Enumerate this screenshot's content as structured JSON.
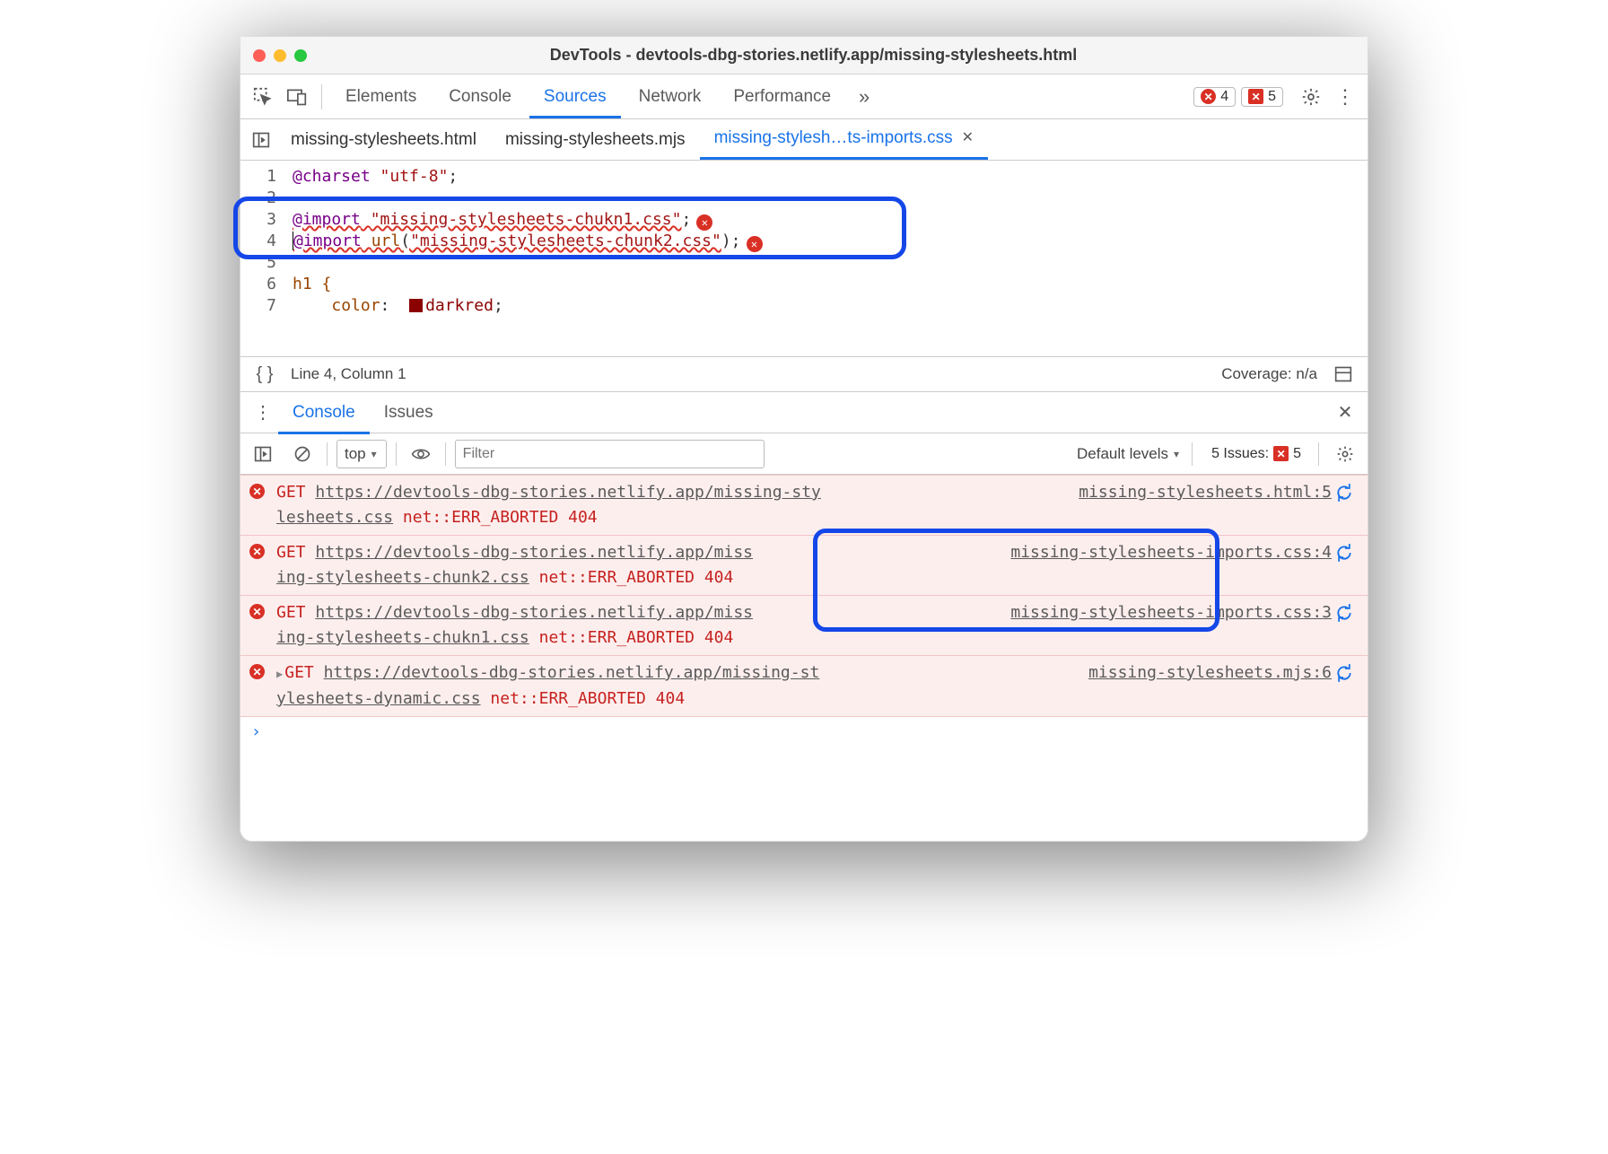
{
  "window_title": "DevTools - devtools-dbg-stories.netlify.app/missing-stylesheets.html",
  "panels": {
    "elements": "Elements",
    "console": "Console",
    "sources": "Sources",
    "network": "Network",
    "performance": "Performance"
  },
  "error_count": "4",
  "issue_count": "5",
  "file_tabs": {
    "t1": "missing-stylesheets.html",
    "t2": "missing-stylesheets.mjs",
    "t3": "missing-stylesh…ts-imports.css"
  },
  "code": {
    "l1a": "@charset",
    "l1b": "\"utf-8\"",
    "l1c": ";",
    "l3a": "@import",
    "l3b": "\"missing-stylesheets-chukn1.css\"",
    "l3c": ";",
    "l4a": "@import",
    "l4b": "url",
    "l4c": "(",
    "l4d": "\"missing-stylesheets-chunk2.css\"",
    "l4e": ");",
    "l6a": "h1 {",
    "l7a": "color",
    "l7b": ": ",
    "l7c": "darkred",
    "l7d": ";"
  },
  "status": {
    "pos": "Line 4, Column 1",
    "cov": "Coverage: n/a"
  },
  "drawer": {
    "console": "Console",
    "issues": "Issues"
  },
  "consolebar": {
    "context": "top",
    "filter_ph": "Filter",
    "levels": "Default levels",
    "issues_label": "5 Issues:",
    "issues_count": "5"
  },
  "messages": {
    "m1": {
      "get": "GET",
      "u1": "https://devtools-dbg-stories.netlify.app/missing-sty",
      "src": "missing-stylesheets.html:5",
      "u2": "lesheets.css",
      "err": "net::ERR_ABORTED 404"
    },
    "m2": {
      "get": "GET",
      "u1": "https://devtools-dbg-stories.netlify.app/miss",
      "src": "missing-stylesheets-imports.css:4",
      "u2": "ing-stylesheets-chunk2.css",
      "err": "net::ERR_ABORTED 404"
    },
    "m3": {
      "get": "GET",
      "u1": "https://devtools-dbg-stories.netlify.app/miss",
      "src": "missing-stylesheets-imports.css:3",
      "u2": "ing-stylesheets-chukn1.css",
      "err": "net::ERR_ABORTED 404"
    },
    "m4": {
      "get": "GET",
      "u1": "https://devtools-dbg-stories.netlify.app/missing-st",
      "src": "missing-stylesheets.mjs:6",
      "u2": "ylesheets-dynamic.css",
      "err": "net::ERR_ABORTED 404"
    }
  }
}
